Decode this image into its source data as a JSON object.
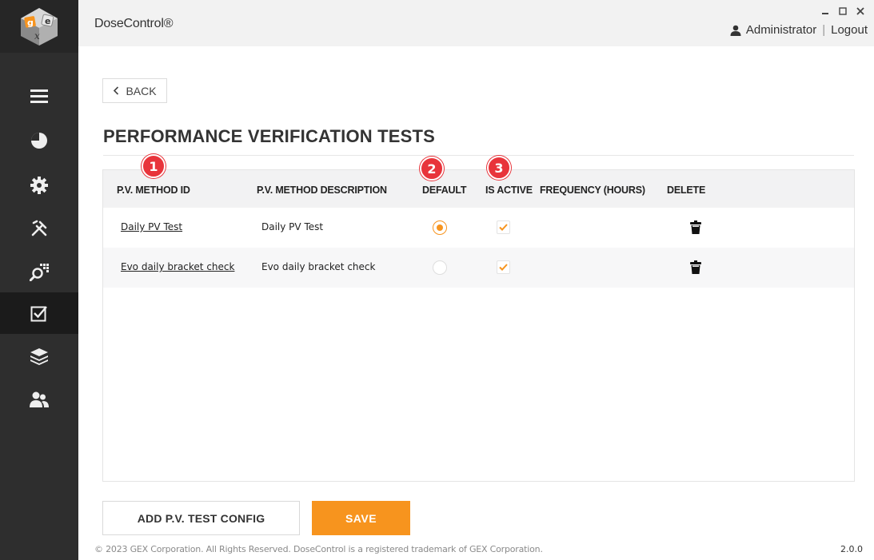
{
  "app": {
    "title": "DoseControl®",
    "user": "Administrator",
    "separator": "|",
    "logout": "Logout",
    "logo_text": "gex"
  },
  "window": {
    "minimize_icon": "minimize-icon",
    "maximize_icon": "maximize-icon",
    "close_icon": "close-icon"
  },
  "sidebar": {
    "items": [
      {
        "icon": "menu-icon",
        "active": false
      },
      {
        "icon": "dashboard-icon",
        "active": false
      },
      {
        "icon": "settings-icon",
        "active": false
      },
      {
        "icon": "tools-icon",
        "active": false
      },
      {
        "icon": "scan-search-icon",
        "active": false
      },
      {
        "icon": "checklist-icon",
        "active": true
      },
      {
        "icon": "layers-icon",
        "active": false
      },
      {
        "icon": "users-icon",
        "active": false
      }
    ]
  },
  "back": {
    "label": "BACK"
  },
  "page": {
    "title": "PERFORMANCE VERIFICATION TESTS"
  },
  "table": {
    "columns": [
      "P.V. METHOD ID",
      "P.V. METHOD DESCRIPTION",
      "DEFAULT",
      "IS ACTIVE",
      "FREQUENCY (HOURS)",
      "DELETE"
    ],
    "rows": [
      {
        "method_id": "Daily PV Test",
        "description": "Daily PV Test",
        "default": true,
        "active": true,
        "frequency": ""
      },
      {
        "method_id": "Evo daily bracket check",
        "description": "Evo daily bracket check",
        "default": false,
        "active": true,
        "frequency": ""
      }
    ]
  },
  "annotations": [
    "1",
    "2",
    "3"
  ],
  "actions": {
    "add_label": "ADD P.V. TEST CONFIG",
    "save_label": "SAVE"
  },
  "footer": {
    "copyright": "© 2023 GEX Corporation. All Rights Reserved. DoseControl is a registered trademark of GEX Corporation.",
    "version": "2.0.0"
  },
  "colors": {
    "accent": "#f7941e",
    "sidebar": "#2e2e2e",
    "badge": "#e8343b"
  }
}
